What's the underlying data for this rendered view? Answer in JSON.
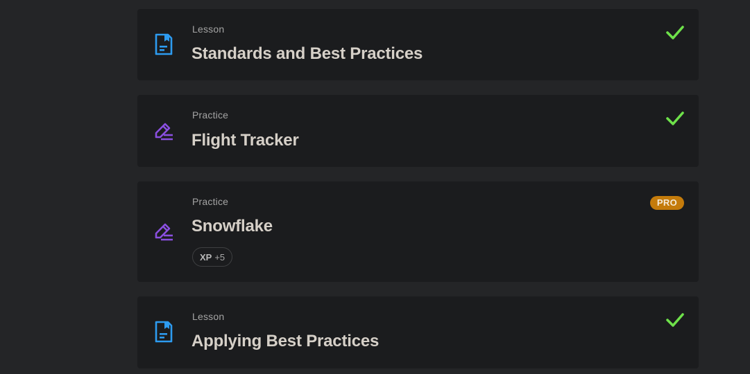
{
  "items": [
    {
      "kind": "Lesson",
      "title": "Standards and Best Practices",
      "icon": "lesson-doc-icon",
      "status": "completed",
      "colors": {
        "icon": "#2d9bf0",
        "check": "#6ee14a"
      }
    },
    {
      "kind": "Practice",
      "title": "Flight Tracker",
      "icon": "practice-pencil-icon",
      "status": "completed",
      "colors": {
        "icon": "#8a4fe0",
        "check": "#6ee14a"
      }
    },
    {
      "kind": "Practice",
      "title": "Snowflake",
      "icon": "practice-pencil-icon",
      "status": "locked-pro",
      "badge": "PRO",
      "xp_label": "XP",
      "xp_value": "+5",
      "colors": {
        "icon": "#8a4fe0",
        "badge": "#c47b0b"
      }
    },
    {
      "kind": "Lesson",
      "title": "Applying Best Practices",
      "icon": "lesson-doc-icon",
      "status": "completed",
      "colors": {
        "icon": "#2d9bf0",
        "check": "#6ee14a"
      }
    }
  ]
}
